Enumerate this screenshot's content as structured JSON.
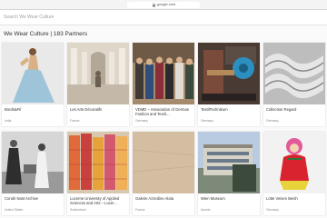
{
  "browser": {
    "url": "google.com"
  },
  "search": {
    "placeholder": "Search We Wear Culture"
  },
  "header": {
    "title": "We Wear Culture | 183 Partners"
  },
  "partners": [
    {
      "name": "Bords&Fil",
      "country": "India"
    },
    {
      "name": "Les Arts Décoratifs",
      "country": "France"
    },
    {
      "name": "VDMD – Association of German Fashion and Textil…",
      "country": "Germany"
    },
    {
      "name": "TextilTechnikum",
      "country": "Germany"
    },
    {
      "name": "Collection Regard",
      "country": "Germany"
    },
    {
      "name": "Condé Nast Archive",
      "country": "United States"
    },
    {
      "name": "Lucerne University of Applied Sciences and Arts – Lucer…",
      "country": "Switzerland"
    },
    {
      "name": "Galerie Azzedine Alaïa",
      "country": "France"
    },
    {
      "name": "Wien Museum",
      "country": "Austria"
    },
    {
      "name": "Lotte Veisen Beish",
      "country": "Germany"
    }
  ]
}
